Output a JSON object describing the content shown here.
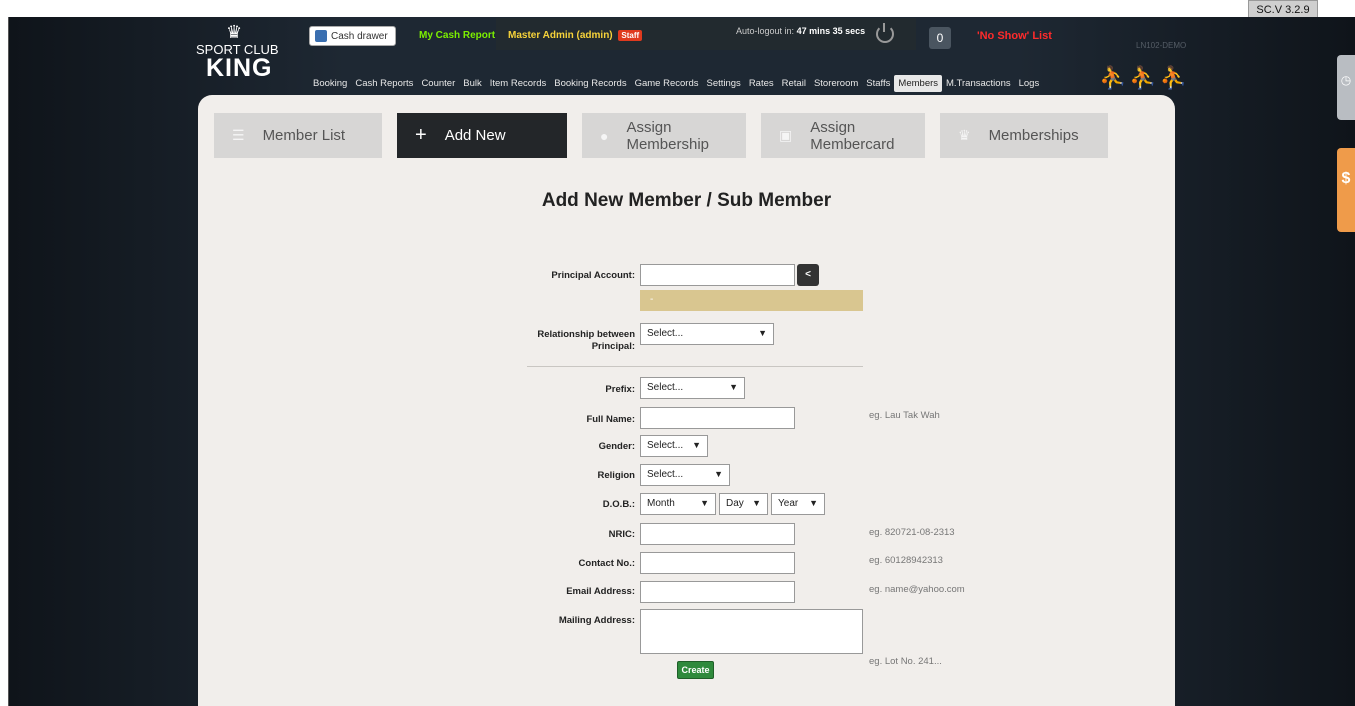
{
  "header": {
    "logo_top": "SPORT CLUB",
    "logo_bottom": "KING",
    "cash_drawer_label": "Cash drawer",
    "my_cash_report_label": "My Cash Report",
    "admin_name": "Master Admin (admin)",
    "staff_badge": "Staff",
    "autologout_prefix": "Auto-logout in:",
    "autologout_time": "47 mins 35 secs",
    "counter_value": "0",
    "no_show_label": "'No Show' List",
    "ln_demo": "LN102-DEMO",
    "version": "SC.V 3.2.9"
  },
  "nav": {
    "items": [
      "Booking",
      "Cash Reports",
      "Counter",
      "Bulk",
      "Item Records",
      "Booking Records",
      "Game Records",
      "Settings",
      "Rates",
      "Retail",
      "Storeroom",
      "Staffs",
      "Members",
      "M.Transactions",
      "Logs"
    ],
    "active": "Members"
  },
  "tabs": [
    {
      "label": "Member List",
      "icon": "list-icon"
    },
    {
      "label": "Add New",
      "icon": "plus-icon",
      "active": true
    },
    {
      "label": "Assign Membership",
      "icon": "user-icon"
    },
    {
      "label": "Assign Membercard",
      "icon": "card-icon"
    },
    {
      "label": "Memberships",
      "icon": "crown-icon"
    }
  ],
  "form": {
    "title": "Add New Member / Sub Member",
    "principal_account_label": "Principal Account:",
    "principal_account_value": "",
    "lookup_button": "<",
    "principal_info": "-",
    "relationship_label_1": "Relationship between",
    "relationship_label_2": "Principal:",
    "relationship_value": "Select...",
    "prefix_label": "Prefix:",
    "prefix_value": "Select...",
    "fullname_label": "Full Name:",
    "fullname_hint": "eg. Lau Tak Wah",
    "gender_label": "Gender:",
    "gender_value": "Select...",
    "religion_label": "Religion",
    "religion_value": "Select...",
    "dob_label": "D.O.B.:",
    "dob_month": "Month",
    "dob_day": "Day",
    "dob_year": "Year",
    "nric_label": "NRIC:",
    "nric_hint": "eg. 820721-08-2313",
    "contact_label": "Contact No.:",
    "contact_hint": "eg. 60128942313",
    "email_label": "Email Address:",
    "email_hint": "eg. name@yahoo.com",
    "mailing_label": "Mailing Address:",
    "mailing_hint": "eg. Lot No. 241...",
    "create_button": "Create"
  },
  "colors": {
    "panel_bg": "#f1eeeb",
    "active_tab": "#232629",
    "no_show": "#ff2b2b",
    "my_cash": "#7cf000",
    "admin": "#f7d33a",
    "create": "#2f8a3c",
    "principal_info_bg": "#d9c690"
  }
}
